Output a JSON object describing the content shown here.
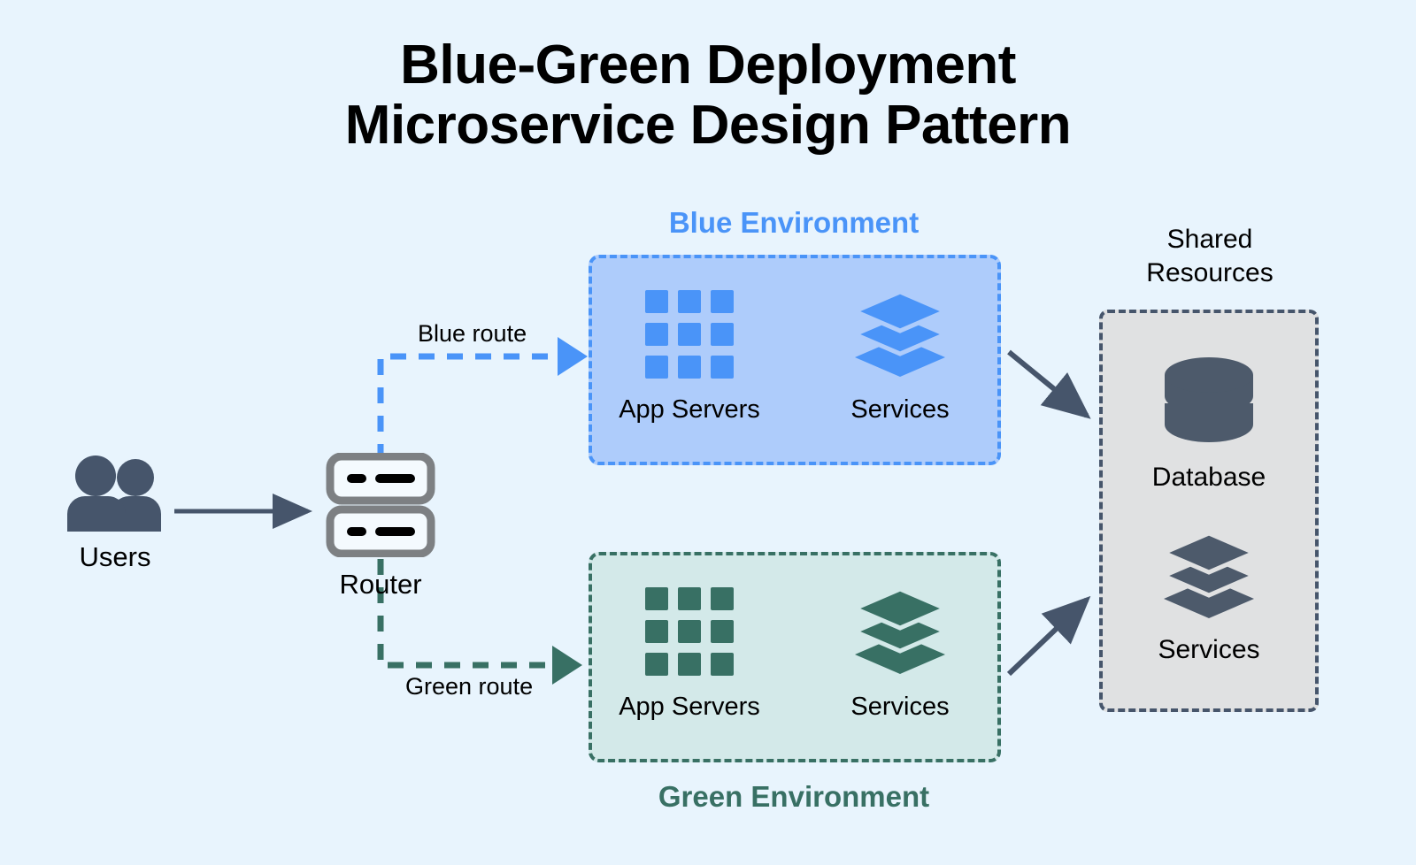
{
  "title": {
    "line1": "Blue-Green Deployment",
    "line2": "Microservice Design Pattern"
  },
  "colors": {
    "page_background": "#e8f4fd",
    "blue_accent": "#4a94f8",
    "blue_fill": "#aeccfb",
    "green_accent": "#387064",
    "green_fill": "#d3e9e9",
    "slate": "#46556b",
    "shared_fill": "#e0e1e2"
  },
  "users": {
    "label": "Users",
    "icon": "users-group-icon"
  },
  "router": {
    "label": "Router",
    "icon": "router-icon"
  },
  "edges": {
    "users_to_router": "",
    "blue_route_label": "Blue route",
    "green_route_label": "Green route"
  },
  "blue_environment": {
    "heading": "Blue Environment",
    "items": [
      {
        "label": "App Servers",
        "icon": "grid-nine-squares-icon"
      },
      {
        "label": "Services",
        "icon": "stacked-layers-icon"
      }
    ]
  },
  "green_environment": {
    "heading": "Green Environment",
    "items": [
      {
        "label": "App Servers",
        "icon": "grid-nine-squares-icon"
      },
      {
        "label": "Services",
        "icon": "stacked-layers-icon"
      }
    ]
  },
  "shared_resources": {
    "heading_line1": "Shared",
    "heading_line2": "Resources",
    "items": [
      {
        "label": "Database",
        "icon": "database-cylinder-icon"
      },
      {
        "label": "Services",
        "icon": "stacked-layers-icon"
      }
    ]
  }
}
